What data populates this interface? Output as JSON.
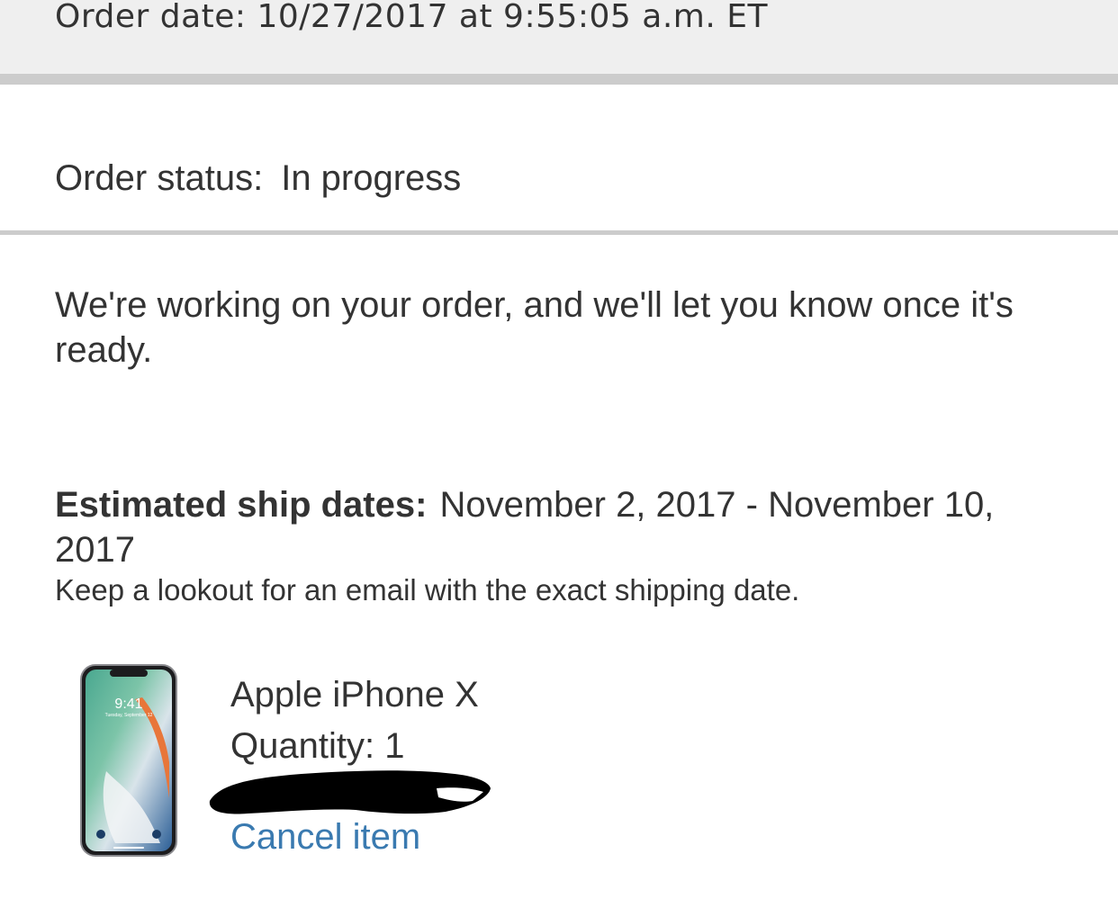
{
  "order": {
    "date_text": "Order date: 10/27/2017 at 9:55:05 a.m. ET",
    "status_label": "Order status:",
    "status_value": "In progress",
    "message": "We're working on your order, and we'll let you know once it's ready.",
    "ship_label": "Estimated ship dates:",
    "ship_dates": "November 2, 2017 - November 10, 2017",
    "ship_note": "Keep a lookout for an email with the exact shipping date."
  },
  "item": {
    "name": "Apple iPhone X",
    "quantity_text": "Quantity: 1",
    "cancel_label": "Cancel item",
    "thumb_time": "9:41",
    "thumb_date": "Tuesday, September 12"
  },
  "colors": {
    "header_bg": "#efefef",
    "rule": "#cccccc",
    "text": "#333333",
    "link": "#3a7ab0"
  }
}
